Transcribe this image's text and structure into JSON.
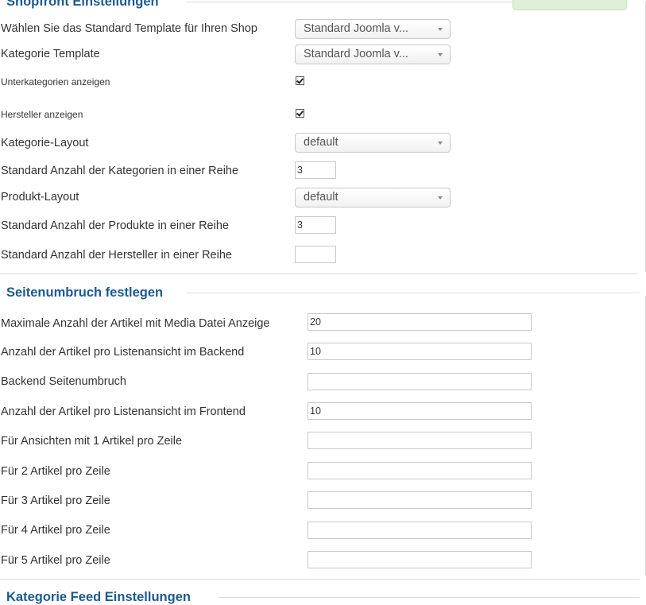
{
  "sections": {
    "shopfront": {
      "title": "Shopfront Einstellungen"
    },
    "pagination": {
      "title": "Seitenumbruch festlegen"
    },
    "feed": {
      "title": "Kategorie Feed Einstellungen"
    }
  },
  "shopfront": {
    "template_label": "Wählen Sie das Standard Template für Ihren Shop",
    "template_value": "Standard Joomla v...",
    "category_template_label": "Kategorie Template",
    "category_template_value": "Standard Joomla v...",
    "show_subcategories_label": "Unterkategorien anzeigen",
    "show_manufacturers_label": "Hersteller anzeigen",
    "category_layout_label": "Kategorie-Layout",
    "category_layout_value": "default",
    "categories_per_row_label": "Standard Anzahl der Kategorien in einer Reihe",
    "categories_per_row_value": "3",
    "product_layout_label": "Produkt-Layout",
    "product_layout_value": "default",
    "products_per_row_label": "Standard Anzahl der Produkte in einer Reihe",
    "products_per_row_value": "3",
    "manufacturers_per_row_label": "Standard Anzahl der Hersteller in einer Reihe",
    "manufacturers_per_row_value": ""
  },
  "pagination": {
    "max_media_label": "Maximale Anzahl der Artikel mit Media Datei Anzeige",
    "max_media_value": "20",
    "backend_list_label": "Anzahl der Artikel pro Listenansicht im Backend",
    "backend_list_value": "10",
    "backend_pagination_label": "Backend Seitenumbruch",
    "backend_pagination_value": "",
    "frontend_list_label": "Anzahl der Artikel pro Listenansicht im Frontend",
    "frontend_list_value": "10",
    "one_per_row_label": "Für Ansichten mit 1 Artikel pro Zeile",
    "one_per_row_value": "",
    "two_per_row_label": "Für 2 Artikel pro Zeile",
    "two_per_row_value": "",
    "three_per_row_label": "Für 3 Artikel pro Zeile",
    "three_per_row_value": "",
    "four_per_row_label": "Für 4 Artikel pro Zeile",
    "four_per_row_value": "",
    "five_per_row_label": "Für 5 Artikel pro Zeile",
    "five_per_row_value": ""
  },
  "colors": {
    "legend": "#1c5a91",
    "border": "#dcdcdc",
    "save_button": "#dff0d8"
  }
}
